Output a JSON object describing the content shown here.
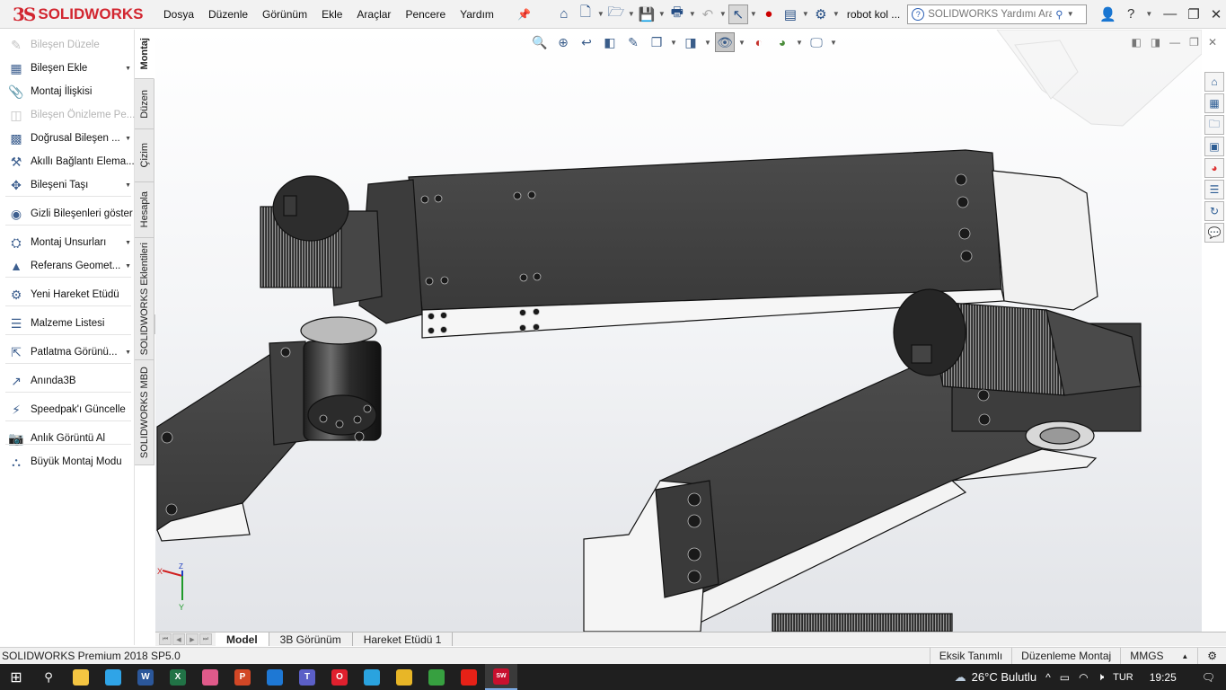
{
  "app": {
    "logo_mark": "3S",
    "logo_text": "SOLIDWORKS",
    "brand_color": "#d22630",
    "menus": [
      "Dosya",
      "Düzenle",
      "Görünüm",
      "Ekle",
      "Araçlar",
      "Pencere",
      "Yardım"
    ],
    "document_title": "robot kol ...",
    "help_search_placeholder": "SOLIDWORKS Yardımı Ara"
  },
  "command_manager": {
    "items": [
      {
        "label": "Bileşen Düzele",
        "icon": "edit-component-icon",
        "enabled": false
      },
      {
        "label": "Bileşen Ekle",
        "icon": "insert-component-icon",
        "enabled": true,
        "dropdown": true
      },
      {
        "label": "Montaj İlişkisi",
        "icon": "paperclip-mate-icon",
        "enabled": true
      },
      {
        "label": "Bileşen Önizleme Pe...",
        "icon": "preview-window-icon",
        "enabled": false
      },
      {
        "label": "Doğrusal Bileşen ...",
        "icon": "linear-pattern-icon",
        "enabled": true,
        "dropdown": true
      },
      {
        "label": "Akıllı Bağlantı Elema...",
        "icon": "smart-fasteners-icon",
        "enabled": true
      },
      {
        "label": "Bileşeni Taşı",
        "icon": "move-component-icon",
        "enabled": true,
        "dropdown": true
      },
      {
        "label": "Gizli Bileşenleri göster",
        "icon": "show-hidden-icon",
        "enabled": true
      },
      {
        "label": "Montaj Unsurları",
        "icon": "assembly-features-icon",
        "enabled": true,
        "dropdown": true
      },
      {
        "label": "Referans Geomet...",
        "icon": "reference-geometry-icon",
        "enabled": true,
        "dropdown": true
      },
      {
        "label": "Yeni Hareket Etüdü",
        "icon": "motion-study-icon",
        "enabled": true
      },
      {
        "label": "Malzeme Listesi",
        "icon": "bill-of-materials-icon",
        "enabled": true
      },
      {
        "label": "Patlatma Görünü...",
        "icon": "exploded-view-icon",
        "enabled": true,
        "dropdown": true
      },
      {
        "label": "Anında3B",
        "icon": "instant3d-icon",
        "enabled": true
      },
      {
        "label": "Speedpak'ı Güncelle",
        "icon": "speedpak-icon",
        "enabled": true
      },
      {
        "label": "Anlık Görüntü Al",
        "icon": "camera-snapshot-icon",
        "enabled": true
      },
      {
        "label": "Büyük Montaj Modu",
        "icon": "large-assembly-icon",
        "enabled": true
      }
    ]
  },
  "vertical_tabs": [
    "Montaj",
    "Düzen",
    "Çizim",
    "Hesapla",
    "SOLIDWORKS Eklentileri",
    "SOLIDWORKS MBD"
  ],
  "bottom_tabs": [
    "Model",
    "3B Görünüm",
    "Hareket Etüdü 1"
  ],
  "triad": {
    "x": "X",
    "y": "Y",
    "z": "Z"
  },
  "status_bar": {
    "product": "SOLIDWORKS Premium 2018 SP5.0",
    "definition": "Eksik Tanımlı",
    "mode": "Düzenleme Montaj",
    "units": "MMGS"
  },
  "taskbar": {
    "weather": "26°C  Bulutlu",
    "language": "TUR",
    "time": "19:25",
    "apps": [
      {
        "name": "file-explorer-icon",
        "glyph": "",
        "color": "#f4c542"
      },
      {
        "name": "edge-icon",
        "glyph": "",
        "color": "#2fa4e7"
      },
      {
        "name": "word-icon",
        "glyph": "W",
        "color": "#2b579a"
      },
      {
        "name": "excel-icon",
        "glyph": "X",
        "color": "#217346"
      },
      {
        "name": "paint-icon",
        "glyph": "",
        "color": "#e05a8a"
      },
      {
        "name": "powerpoint-icon",
        "glyph": "P",
        "color": "#d24726"
      },
      {
        "name": "mail-icon",
        "glyph": "",
        "color": "#1e78d4"
      },
      {
        "name": "teams-icon",
        "glyph": "T",
        "color": "#5b5fc7"
      },
      {
        "name": "opera-icon",
        "glyph": "O",
        "color": "#e0202e"
      },
      {
        "name": "telegram-icon",
        "glyph": "",
        "color": "#2aa3df"
      },
      {
        "name": "chrome-icon",
        "glyph": "",
        "color": "#e8b627"
      },
      {
        "name": "photos-icon",
        "glyph": "",
        "color": "#37a040"
      },
      {
        "name": "youtube-icon",
        "glyph": "",
        "color": "#e62117"
      },
      {
        "name": "solidworks-task-icon",
        "glyph": "SW",
        "color": "#c8102e"
      }
    ]
  }
}
